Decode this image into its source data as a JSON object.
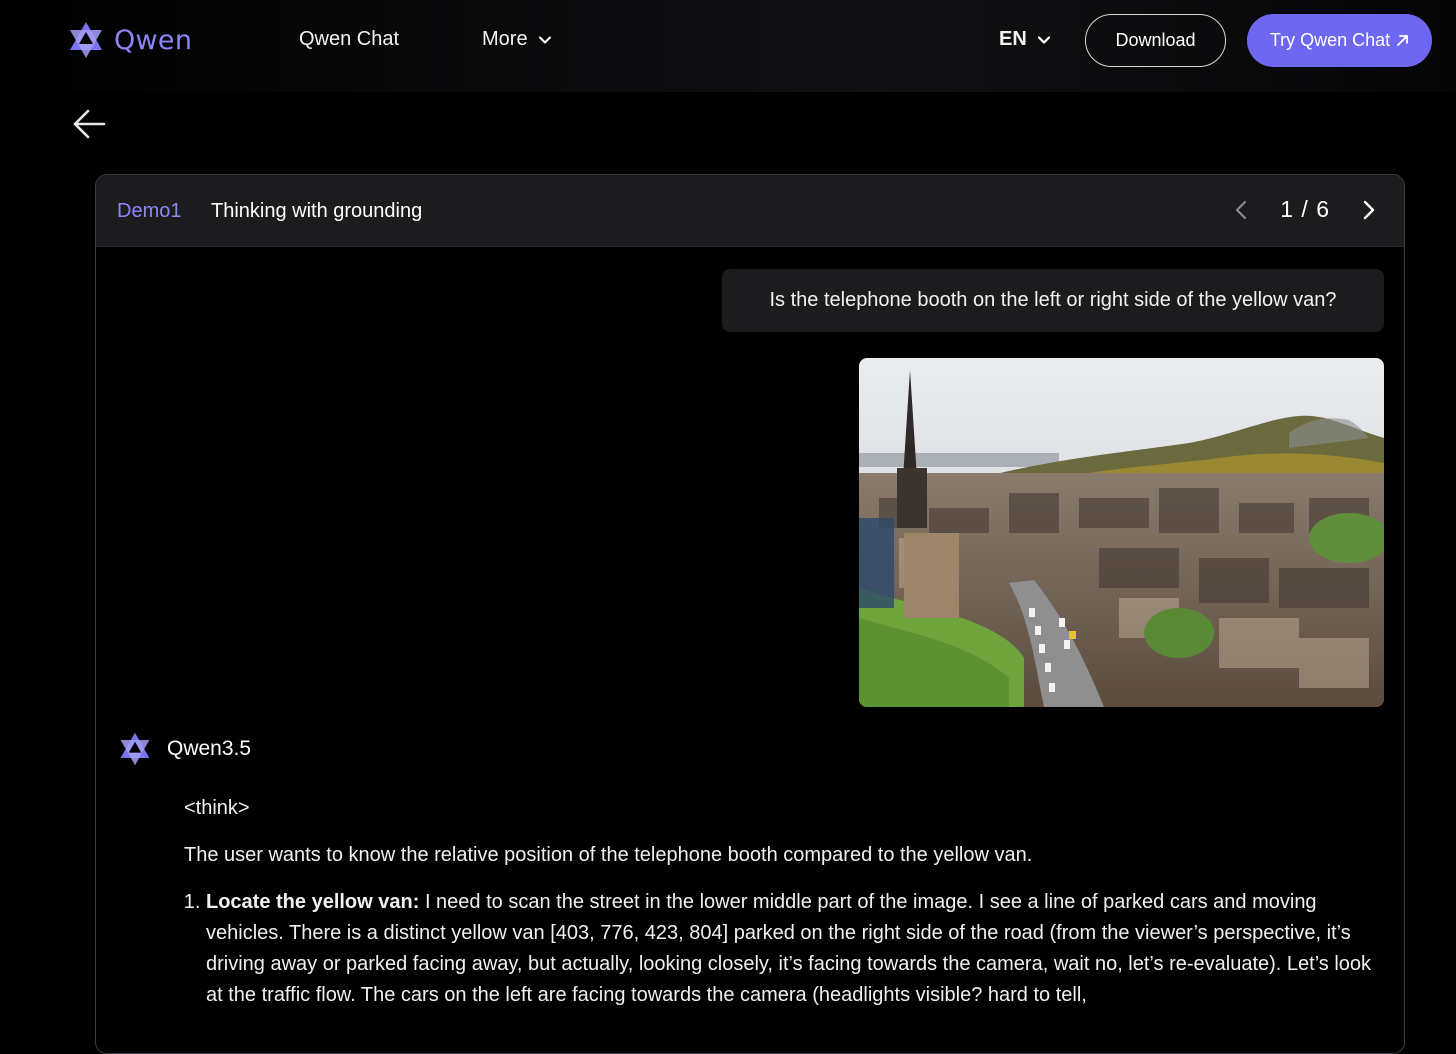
{
  "nav": {
    "logo_text": "Qwen",
    "links": [
      "Qwen Chat",
      "More"
    ],
    "language": "EN",
    "download_label": "Download",
    "try_label": "Try Qwen Chat",
    "accent_color": "#6e67f2"
  },
  "demo": {
    "tag": "Demo1",
    "title": "Thinking with grounding",
    "page_current": "1",
    "page_total": "6",
    "page_separator": "/"
  },
  "conversation": {
    "user_message": "Is the telephone booth on the left or right side of the yellow van?",
    "assistant_name": "Qwen3.5",
    "think_tag": "<think>",
    "intro": "The user wants to know the relative position of the telephone booth compared to the yellow van.",
    "step1_title": "Locate the yellow van:",
    "step1_text": " I need to scan the street in the lower middle part of the image. I see a line of parked cars and moving vehicles. There is a distinct yellow van [403, 776, 423, 804] parked on the right side of the road (from the viewer’s perspective, it’s driving away or parked facing away, but actually, looking closely, it’s facing towards the camera, wait no, let’s re-evaluate). Let’s look at the traffic flow. The cars on the left are facing towards the camera (headlights visible? hard to tell,"
  },
  "icons": {
    "logo": "qwen-logo-icon",
    "back": "arrow-left-icon",
    "prev": "chevron-left-icon",
    "next": "chevron-right-icon",
    "external": "arrow-up-right-icon",
    "dropdown": "chevron-down-icon"
  }
}
